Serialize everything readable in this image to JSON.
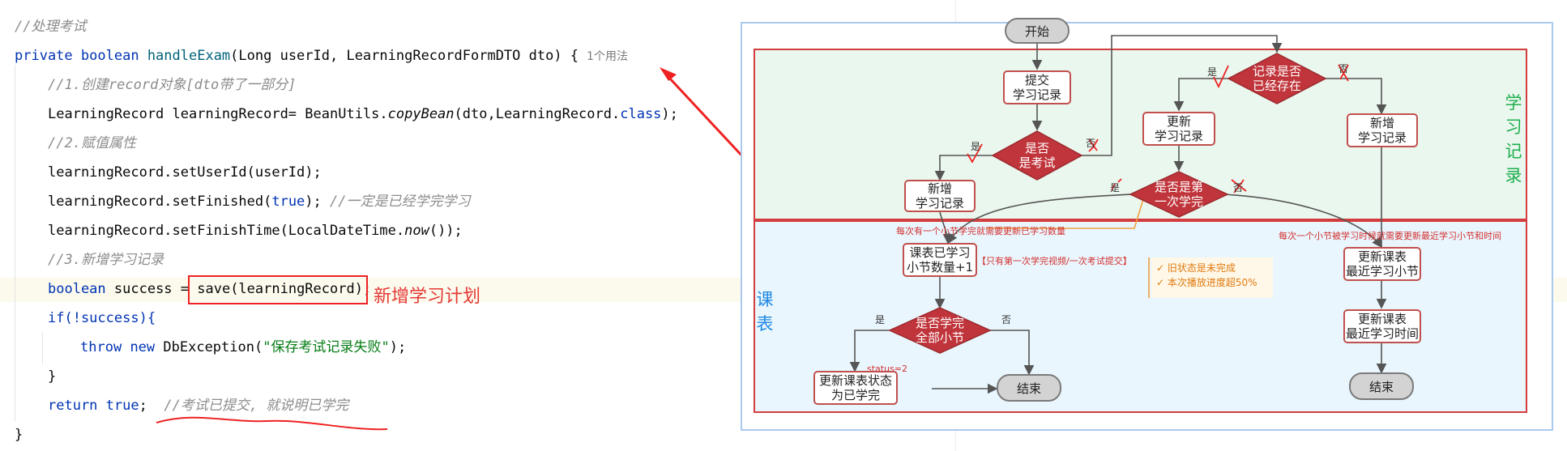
{
  "code": {
    "comment_handle_exam": "//处理考试",
    "sig_private": "private",
    "sig_boolean": "boolean",
    "sig_method": "handleExam",
    "sig_params": "(Long userId, LearningRecordFormDTO dto) {",
    "sig_usage": "1个用法",
    "comment_1": "//1.创建record对象[dto带了一部分]",
    "l_record_a": "LearningRecord learningRecord= BeanUtils.",
    "l_record_b": "copyBean",
    "l_record_c": "(dto,LearningRecord.",
    "l_record_d": "class",
    "l_record_e": ");",
    "comment_2": "//2.赋值属性",
    "l_userid": "learningRecord.setUserId(userId);",
    "l_finished_a": "learningRecord.setFinished(",
    "l_finished_b": "true",
    "l_finished_c": "); ",
    "l_finished_d": "//一定是已经学完学习",
    "l_finishtime_a": "learningRecord.setFinishTime(LocalDateTime.",
    "l_finishtime_b": "now",
    "l_finishtime_c": "());",
    "comment_3": "//3.新增学习记录",
    "l_success_a": "boolean",
    "l_success_b": " success = ",
    "l_success_c": "save(learningRecord);",
    "l_if": "if(!success){",
    "l_throw_a": "throw",
    "l_throw_b": "new",
    "l_throw_c": " DbException(",
    "l_throw_d": "\"保存考试记录失败\"",
    "l_throw_e": ");",
    "l_close_if": "}",
    "l_return_a": "return",
    "l_return_b": "true",
    "l_return_c": ";  ",
    "l_return_d": "//考试已提交, 就说明已学完",
    "l_close": "}"
  },
  "annotation": {
    "label": "新增学习计划",
    "accent": "#e53935"
  },
  "flowchart": {
    "start": "开始",
    "submit_record": "提交\n学习记录",
    "is_exam": "是否\n是考试",
    "add_record_left": "新增\n学习记录",
    "record_exists": "记录是否\n已经存在",
    "update_record": "更新\n学习记录",
    "add_record_right": "新增\n学习记录",
    "is_first_done": "是否是第\n一次学完",
    "yes": "是",
    "no": "否",
    "note_left": "每次有一个小节学完就需要更新已学习数量",
    "note_right": "每次一个小节被学习时候就需要更新最近学习小节和时间",
    "course_count": "课表已学习\n小节数量+1",
    "only_first": "【只有第一次学完视频/一次考试提交】",
    "check1": "✓ 旧状态是未完成",
    "check2": "✓ 本次播放进度超50%",
    "all_done": "是否学完\n全部小节",
    "status": "status=2",
    "update_status": "更新课表状态\n为已学完",
    "end": "结束",
    "update_latest_section": "更新课表\n最近学习小节",
    "update_latest_time": "更新课表\n最近学习时间",
    "zone_study": "学习记录",
    "zone_course": "课表",
    "zone_color_green": "#1fae4e",
    "zone_color_blue": "#1e88e5"
  }
}
